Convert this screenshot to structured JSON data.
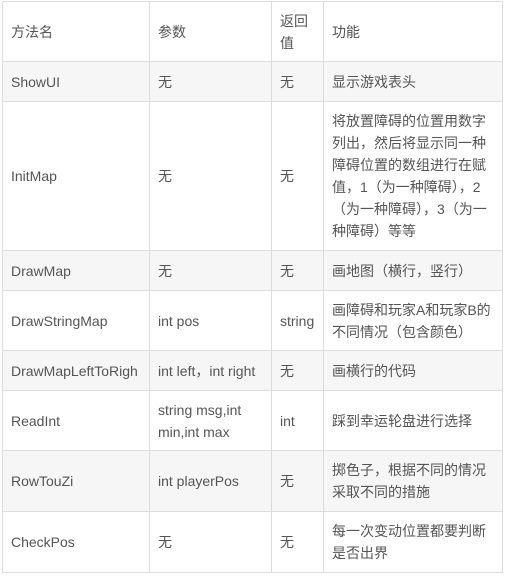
{
  "table": {
    "headers": [
      "方法名",
      "参数",
      "返回值",
      "功能"
    ],
    "rows": [
      {
        "name": "ShowUI",
        "params": "无",
        "ret": "无",
        "desc": "显示游戏表头"
      },
      {
        "name": "InitMap",
        "params": "无",
        "ret": "无",
        "desc": "将放置障碍的位置用数字列出，然后将显示同一种障碍位置的数组进行在赋值，1（为一种障碍），2（为一种障碍），3（为一种障碍）等等"
      },
      {
        "name": "DrawMap",
        "params": "无",
        "ret": "无",
        "desc": "画地图（横行，竖行）"
      },
      {
        "name": "DrawStringMap",
        "params": "int pos",
        "ret": "string",
        "desc": "画障碍和玩家A和玩家B的不同情况（包含颜色）"
      },
      {
        "name": "DrawMapLeftToRigh",
        "params": "int left，int right",
        "ret": "无",
        "desc": "画横行的代码"
      },
      {
        "name": "ReadInt",
        "params": "string msg,int min,int max",
        "ret": "int",
        "desc": "踩到幸运轮盘进行选择"
      },
      {
        "name": "RowTouZi",
        "params": "int playerPos",
        "ret": "无",
        "desc": "掷色子，根据不同的情况采取不同的措施"
      },
      {
        "name": "CheckPos",
        "params": "无",
        "ret": "无",
        "desc": "每一次变动位置都要判断是否出界"
      }
    ]
  }
}
